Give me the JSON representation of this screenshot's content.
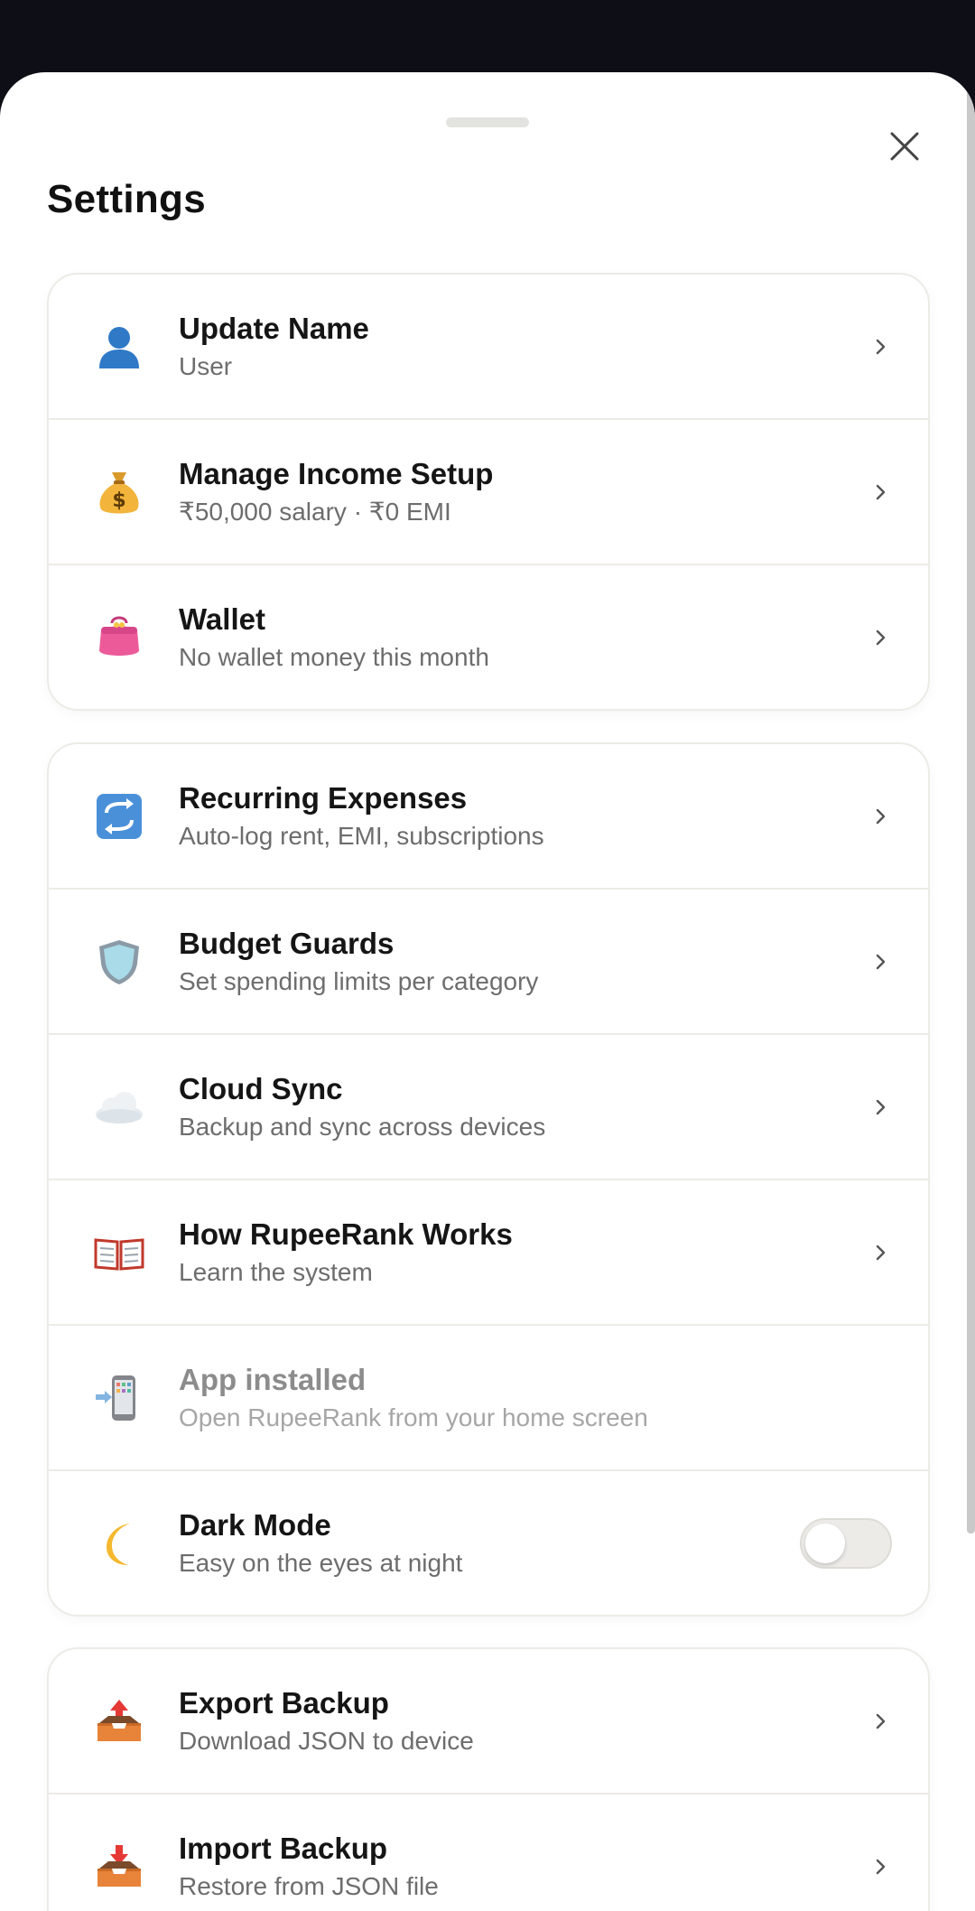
{
  "sheet": {
    "title": "Settings"
  },
  "groups": {
    "account": [
      {
        "label": "Update Name",
        "sub": "User",
        "icon": "user-bust-icon"
      },
      {
        "label": "Manage Income Setup",
        "sub": "₹50,000 salary · ₹0 EMI",
        "icon": "money-bag-icon"
      },
      {
        "label": "Wallet",
        "sub": "No wallet money this month",
        "icon": "purse-icon"
      }
    ],
    "features": [
      {
        "label": "Recurring Expenses",
        "sub": "Auto-log rent, EMI, subscriptions",
        "icon": "recurring-arrows-icon"
      },
      {
        "label": "Budget Guards",
        "sub": "Set spending limits per category",
        "icon": "shield-icon"
      },
      {
        "label": "Cloud Sync",
        "sub": "Backup and sync across devices",
        "icon": "cloud-icon"
      },
      {
        "label": "How RupeeRank Works",
        "sub": "Learn the system",
        "icon": "open-book-icon"
      },
      {
        "label": "App installed",
        "sub": "Open RupeeRank from your home screen",
        "icon": "install-phone-icon"
      },
      {
        "label": "Dark Mode",
        "sub": "Easy on the eyes at night",
        "icon": "crescent-moon-icon",
        "toggle": "off"
      }
    ],
    "data": [
      {
        "label": "Export Backup",
        "sub": "Download JSON to device",
        "icon": "outbox-tray-icon"
      },
      {
        "label": "Import Backup",
        "sub": "Restore from JSON file",
        "icon": "inbox-tray-icon"
      }
    ]
  },
  "colors": {
    "sheet_bg": "#ffffff",
    "backdrop": "#0e0e16",
    "border": "#ecebe6",
    "text_primary": "#151515",
    "text_secondary": "#6d6d6d"
  }
}
